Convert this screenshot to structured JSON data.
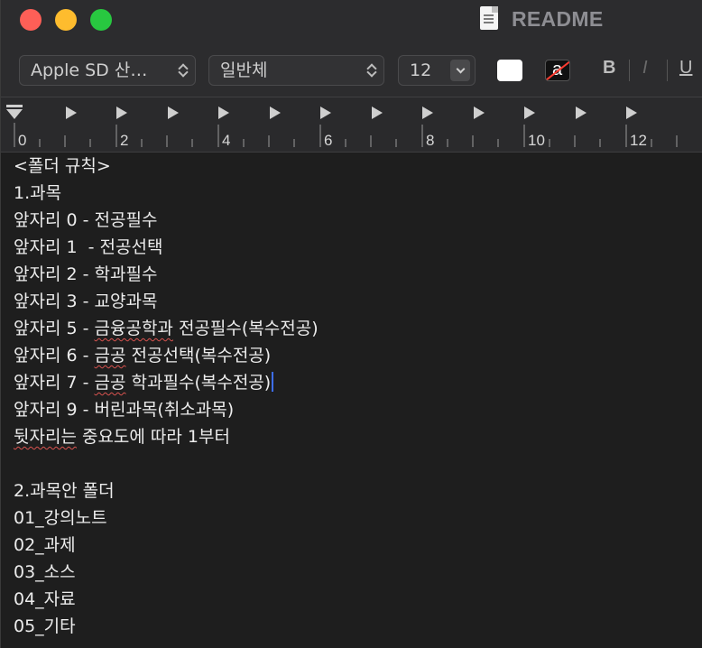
{
  "window": {
    "title": "README"
  },
  "toolbar": {
    "font_family": "Apple SD 산…",
    "font_style": "일반체",
    "font_size": "12",
    "text_color": "#ffffff",
    "bold_label": "B",
    "italic_label": "I",
    "underline_label": "U",
    "bg_color_glyph": "a"
  },
  "ruler": {
    "labels": [
      "0",
      "2",
      "4",
      "6",
      "8",
      "10",
      "12"
    ]
  },
  "document": {
    "lines": [
      "<폴더 규칙>",
      "1.과목",
      "앞자리 0 - 전공필수",
      "앞자리 1  - 전공선택",
      "앞자리 2 - 학과필수",
      "앞자리 3 - 교양과목",
      "앞자리 5 - 금융공학과 전공필수(복수전공)",
      "앞자리 6 - 금공 전공선택(복수전공)",
      "앞자리 7 - 금공 학과필수(복수전공)",
      "앞자리 9 - 버린과목(취소과목)",
      "뒷자리는 중요도에 따라 1부터",
      "",
      "2.과목안 폴더",
      "01_강의노트",
      "02_과제",
      "03_소스",
      "04_자료",
      "05_기타"
    ],
    "misspelled": [
      "금융공학과",
      "금공",
      "금공",
      "뒷자리는"
    ]
  },
  "colors": {
    "close": "#fe5f57",
    "minimize": "#febc2e",
    "maximize": "#28c840",
    "caret": "#3d6df2",
    "spellcheck": "#d9534f"
  }
}
